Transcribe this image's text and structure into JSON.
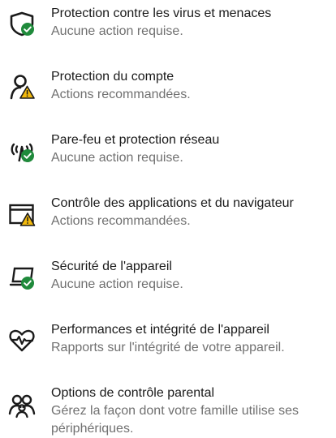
{
  "colors": {
    "ok": "#1f8a3b",
    "warning": "#f2b90d",
    "icon_stroke": "#1a1a1a",
    "status_text": "#707070"
  },
  "items": [
    {
      "title": "Protection contre les virus et menaces",
      "status": "Aucune action requise.",
      "icon": "shield-icon",
      "badge": "check-badge"
    },
    {
      "title": "Protection du compte",
      "status": "Actions recommandées.",
      "icon": "account-person-icon",
      "badge": "warning-badge"
    },
    {
      "title": "Pare-feu et protection réseau",
      "status": "Aucune action requise.",
      "icon": "firewall-antenna-icon",
      "badge": "check-badge"
    },
    {
      "title": "Contrôle des applications et du navigateur",
      "status": "Actions recommandées.",
      "icon": "app-browser-window-icon",
      "badge": "warning-badge"
    },
    {
      "title": "Sécurité de l'appareil",
      "status": "Aucune action requise.",
      "icon": "device-laptop-icon",
      "badge": "check-badge"
    },
    {
      "title": "Performances et intégrité de l'appareil",
      "status": "Rapports sur l'intégrité de votre appareil.",
      "icon": "heart-pulse-icon",
      "badge": ""
    },
    {
      "title": "Options de contrôle parental",
      "status": "Gérez la façon dont votre famille utilise ses périphériques.",
      "icon": "family-icon",
      "badge": ""
    }
  ]
}
